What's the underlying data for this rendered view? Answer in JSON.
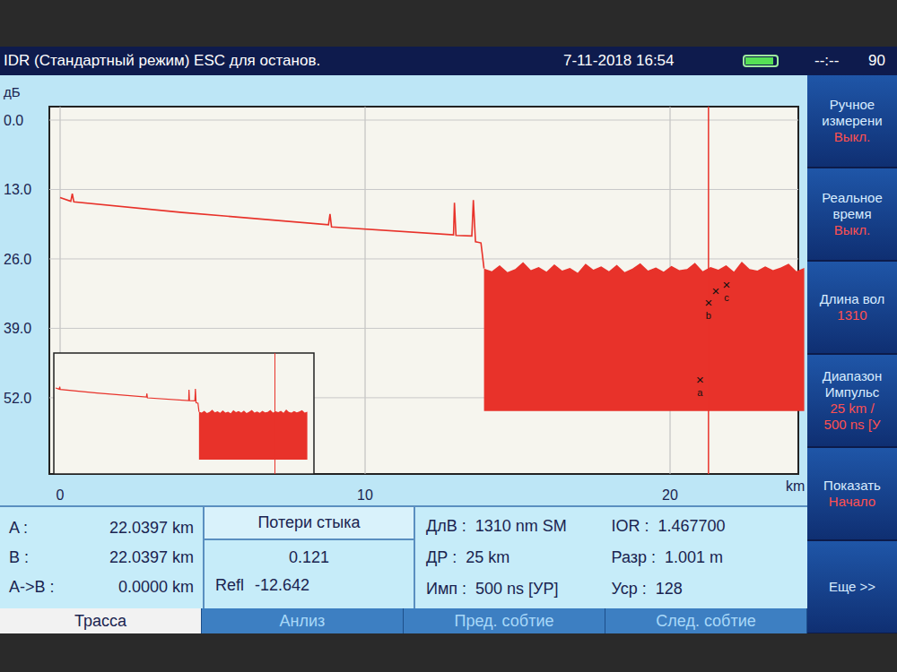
{
  "top_bar": {
    "title": "IDR (Стандартный режим) ESC для останов.",
    "datetime": "7-11-2018 16:54",
    "battery_level": 0.9,
    "timer": "--:--",
    "battery_percent": "90"
  },
  "chart": {
    "unit_label": "дБ",
    "x_unit": "km",
    "y_ticks": [
      {
        "label": "0.0",
        "value": 0
      },
      {
        "label": "13.0",
        "value": 13
      },
      {
        "label": "26.0",
        "value": 26
      },
      {
        "label": "39.0",
        "value": 39
      },
      {
        "label": "52.0",
        "value": 52
      }
    ],
    "x_ticks": [
      {
        "label": "0",
        "value": 0
      },
      {
        "label": "10",
        "value": 10
      },
      {
        "label": "20",
        "value": 20
      }
    ],
    "trace": [
      [
        0,
        14.5
      ],
      [
        0.35,
        15.2
      ],
      [
        0.4,
        13.8
      ],
      [
        0.45,
        15.3
      ],
      [
        4,
        17.3
      ],
      [
        8.8,
        19.6
      ],
      [
        8.85,
        17.6
      ],
      [
        8.9,
        20.0
      ],
      [
        12.9,
        21.5
      ],
      [
        12.93,
        15.5
      ],
      [
        12.98,
        21.6
      ],
      [
        13.5,
        21.7
      ],
      [
        13.55,
        15.0
      ],
      [
        13.62,
        22.8
      ],
      [
        13.8,
        23.0
      ],
      [
        13.9,
        27.8
      ]
    ],
    "noise": {
      "from_km": 13.9,
      "to_km": 24.4,
      "bottom_db": 54.5,
      "top_db": [
        27.8,
        28.3,
        27.2,
        28.5,
        27.9,
        26.6,
        28.1,
        27.5,
        28.4,
        27.0,
        28.2,
        27.7,
        28.6,
        26.9,
        28.0,
        27.4,
        28.3,
        27.1,
        28.5,
        27.8,
        26.8,
        28.2,
        27.6,
        28.4,
        27.3,
        28.1,
        27.9,
        26.7,
        28.3,
        27.5,
        28.0,
        27.2,
        28.4,
        26.5,
        27.9,
        28.2,
        27.4,
        28.1,
        27.6,
        26.9,
        28.3,
        27.7
      ]
    },
    "cursor_km": 21.26,
    "markers": [
      {
        "symbol": "×",
        "label": "a",
        "km": 20.98,
        "db": 48.6
      },
      {
        "symbol": "×",
        "label": "b",
        "km": 21.26,
        "db": 34.2
      },
      {
        "symbol": "×",
        "label": "",
        "km": 21.5,
        "db": 32.0
      },
      {
        "symbol": "×",
        "label": "c",
        "km": 21.85,
        "db": 30.8
      }
    ]
  },
  "right_menu": [
    {
      "lines": [
        "Ручное",
        "измерени"
      ],
      "values": [
        "Выкл."
      ]
    },
    {
      "lines": [
        "Реальное",
        "время"
      ],
      "values": [
        "Выкл."
      ]
    },
    {
      "lines": [
        "Длина вол"
      ],
      "values": [
        "1310"
      ]
    },
    {
      "lines": [
        "Диапазон",
        "Импульс"
      ],
      "values": [
        "25 km /",
        "500 ns [У"
      ]
    },
    {
      "lines": [
        "Показать"
      ],
      "values": [
        "Начало"
      ]
    },
    {
      "lines": [
        "Еще >>"
      ],
      "values": []
    }
  ],
  "cursors": [
    {
      "label": "A :",
      "value": "22.0397 km"
    },
    {
      "label": "B :",
      "value": "22.0397 km"
    },
    {
      "label": "A->B :",
      "value": "0.0000 km"
    }
  ],
  "splice_loss": {
    "title": "Потери стыка",
    "value": "0.121",
    "refl_label": "Refl",
    "refl_value": "-12.642"
  },
  "parameters": [
    {
      "label": "ДлВ :",
      "value": "1310 nm SM"
    },
    {
      "label": "IOR :",
      "value": "1.467700"
    },
    {
      "label": "ДР :",
      "value": "25 km"
    },
    {
      "label": "Разр :",
      "value": "1.001 m"
    },
    {
      "label": "Имп :",
      "value": "500 ns [УР]"
    },
    {
      "label": "Уср :",
      "value": "128"
    }
  ],
  "tabs": [
    {
      "label": "Трасса",
      "selected": true
    },
    {
      "label": "Анлиз",
      "selected": false
    },
    {
      "label": "Пред. собтие",
      "selected": false
    },
    {
      "label": "След. собтие",
      "selected": false
    }
  ]
}
